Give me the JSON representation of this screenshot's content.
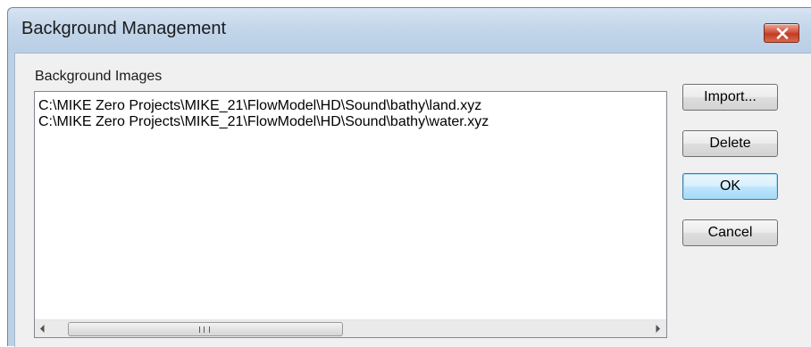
{
  "window": {
    "title": "Background Management",
    "close_glyph": "×"
  },
  "group": {
    "label": "Background Images"
  },
  "list": {
    "items": [
      "C:\\MIKE Zero Projects\\MIKE_21\\FlowModel\\HD\\Sound\\bathy\\land.xyz",
      "C:\\MIKE Zero Projects\\MIKE_21\\FlowModel\\HD\\Sound\\bathy\\water.xyz"
    ]
  },
  "buttons": {
    "import": "Import...",
    "delete": "Delete",
    "ok": "OK",
    "cancel": "Cancel"
  },
  "icons": {
    "close": "close-icon",
    "scroll_left": "left-arrow-icon",
    "scroll_right": "right-arrow-icon"
  },
  "colors": {
    "title_bar": "#c3d6ea",
    "close_button": "#c23c24",
    "default_button_border": "#3c7fb1"
  }
}
